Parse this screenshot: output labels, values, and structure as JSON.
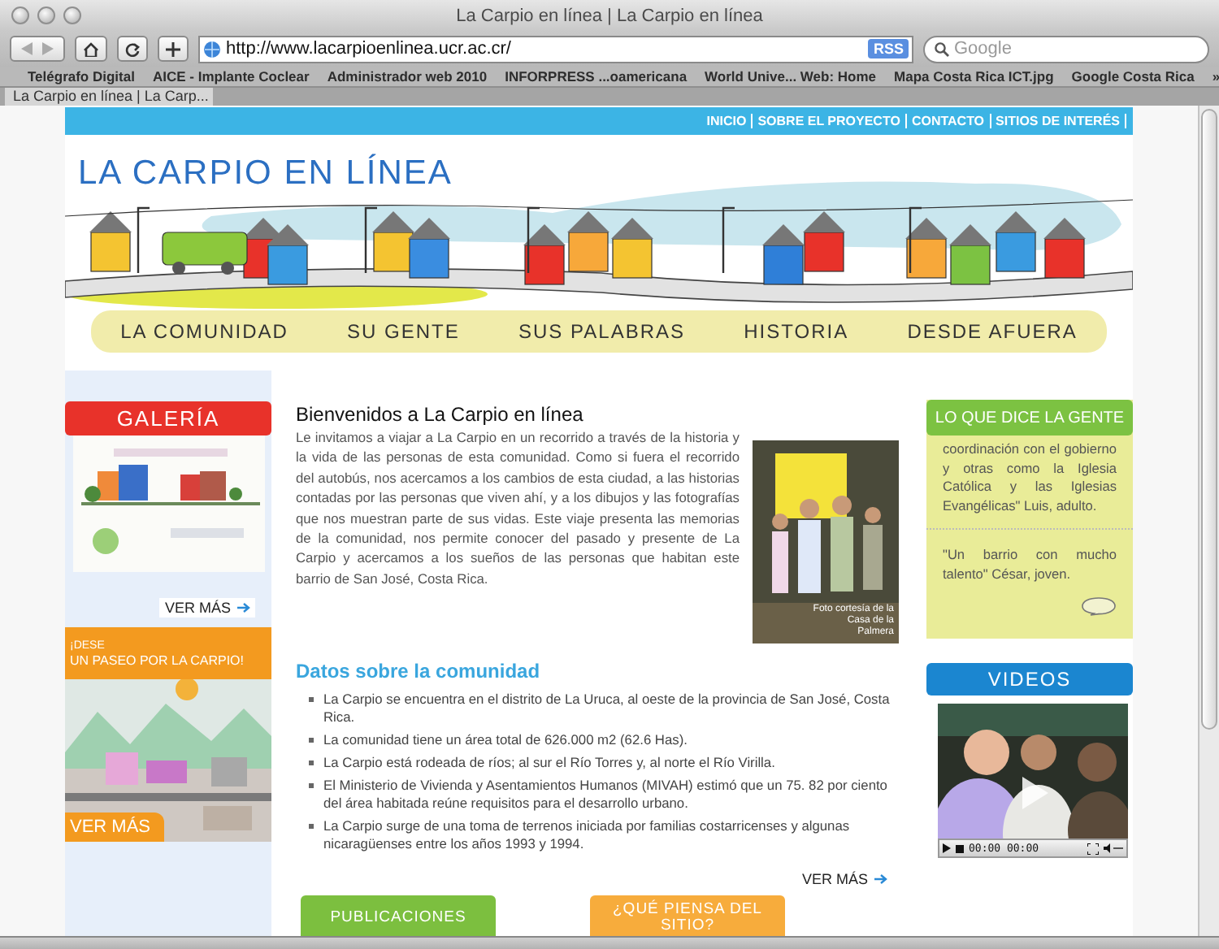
{
  "window": {
    "title": "La Carpio en línea | La Carpio en línea"
  },
  "toolbar": {
    "address": "http://www.lacarpioenlinea.ucr.ac.cr/",
    "rss_badge": "RSS",
    "search": {
      "placeholder": "Google"
    }
  },
  "bookmarks": [
    "Telégrafo Digital",
    "AICE - Implante Coclear",
    "Administrador web 2010",
    "INFORPRESS ...oamericana",
    "World Unive... Web: Home",
    "Mapa Costa Rica ICT.jpg",
    "Google Costa Rica"
  ],
  "bookmarks_more": "»",
  "tabs": [
    {
      "label": "La Carpio en línea | La Carp...",
      "selected": true
    }
  ],
  "top_nav": [
    "INICIO",
    "SOBRE EL PROYECTO",
    "CONTACTO",
    "SITIOS DE INTERÉS"
  ],
  "logo": "LA CARPIO EN LÍNEA",
  "section_nav": [
    "LA COMUNIDAD",
    "SU GENTE",
    "SUS PALABRAS",
    "HISTORIA",
    "DESDE AFUERA"
  ],
  "gallery": {
    "title": "GALERÍA",
    "more": "VER MÁS"
  },
  "walk": {
    "title_small": "¡DESE",
    "title": "UN PASEO POR LA CARPIO!",
    "more": "VER MÁS"
  },
  "welcome": {
    "heading": "Bienvenidos a La Carpio en línea",
    "body": "Le invitamos a viajar a La Carpio en un recorrido a través de la historia y la vida de las personas de esta comunidad. Como si fuera el recorrido del autobús, nos acercamos a los cambios de esta ciudad, a las historias contadas por las personas que viven ahí, y a los dibujos y las fotografías que nos muestran parte de sus vidas. Este viaje presenta las memorias de la comunidad, nos permite conocer del pasado y presente de La Carpio y acercamos a los sueños de las personas que habitan este barrio de San José, Costa Rica.",
    "photo_caption": "Foto cortesía de la Casa de la Palmera"
  },
  "facts": {
    "heading": "Datos sobre la comunidad",
    "items": [
      "La Carpio se encuentra en el distrito de La Uruca, al oeste de la provincia de San José, Costa Rica.",
      "La comunidad tiene un área total de 626.000 m2 (62.6 Has).",
      "La Carpio está rodeada de ríos; al sur el Río Torres y, al norte el Río Virilla.",
      "El Ministerio de Vivienda y Asentamientos Humanos (MIVAH) estimó que un 75. 82 por ciento del área habitada reúne requisitos para el desarrollo urbano.",
      "La Carpio surge de una toma de terrenos iniciada por familias costarricenses y algunas nicaragüenses entre los años 1993 y 1994."
    ],
    "more": "VER MÁS"
  },
  "tags": [
    {
      "label": "PUBLICACIONES",
      "color": "#7cbf3f"
    },
    {
      "label": "¿QUÉ PIENSA DEL SITIO?",
      "color": "#f7ac3c"
    }
  ],
  "testimonials": {
    "title": "LO QUE DICE LA GENTE",
    "quotes": [
      "coordinación con el gobierno y otras como la Iglesia Católica y las Iglesias Evangélicas\" Luis, adulto.",
      "\"Un barrio con mucho talento\" César, joven."
    ]
  },
  "videos": {
    "title": "VIDEOS",
    "time": "00:00 00:00"
  }
}
